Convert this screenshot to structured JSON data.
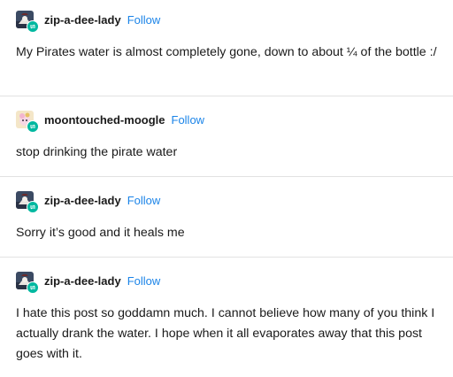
{
  "posts": [
    {
      "username": "zip-a-dee-lady",
      "follow_label": "Follow",
      "text": "My Pirates water is almost completely gone, down to about ¼ of the bottle :/"
    },
    {
      "username": "moontouched-moogle",
      "follow_label": "Follow",
      "text": "stop drinking the pirate water"
    },
    {
      "username": "zip-a-dee-lady",
      "follow_label": "Follow",
      "text": "Sorry it’s good and it heals me"
    },
    {
      "username": "zip-a-dee-lady",
      "follow_label": "Follow",
      "text": "I hate this post so goddamn much. I cannot believe how many of you think I actually drank the water. I hope when it all evaporates away that this post goes with it."
    }
  ],
  "colors": {
    "follow": "#1b84e8",
    "badge": "#00b8a0",
    "divider": "#e2e2e2"
  }
}
